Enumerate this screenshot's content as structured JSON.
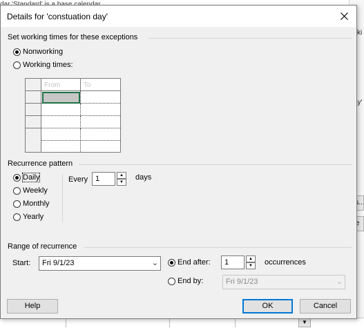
{
  "background": {
    "top_text": "dar 'Standard' is a base calendar.",
    "right_texts": [
      "ki",
      "ay'"
    ],
    "right_buttons": [
      "ls...",
      "te"
    ]
  },
  "dialog": {
    "title": "Details for 'constuation day'",
    "close_icon": "close-icon"
  },
  "working_times": {
    "group_label": "Set working times for these exceptions",
    "nonworking_label": "Nonworking",
    "working_times_label": "Working times:",
    "selected": "Nonworking",
    "grid_headers": [
      "From",
      "To"
    ],
    "grid_rows": 5
  },
  "recurrence": {
    "group_label": "Recurrence pattern",
    "options": [
      "Daily",
      "Weekly",
      "Monthly",
      "Yearly"
    ],
    "selected": "Daily",
    "every_label": "Every",
    "every_value": "1",
    "days_label": "days"
  },
  "range": {
    "group_label": "Range of recurrence",
    "start_label": "Start:",
    "start_value": "Fri 9/1/23",
    "end_after_label": "End after:",
    "end_after_value": "1",
    "occurrences_label": "occurrences",
    "end_by_label": "End by:",
    "end_by_value": "Fri 9/1/23",
    "selected": "End after"
  },
  "buttons": {
    "help": "Help",
    "ok": "OK",
    "cancel": "Cancel"
  },
  "colors": {
    "default_button_border": "#0078d7",
    "selected_cell_border": "#1e7145"
  }
}
